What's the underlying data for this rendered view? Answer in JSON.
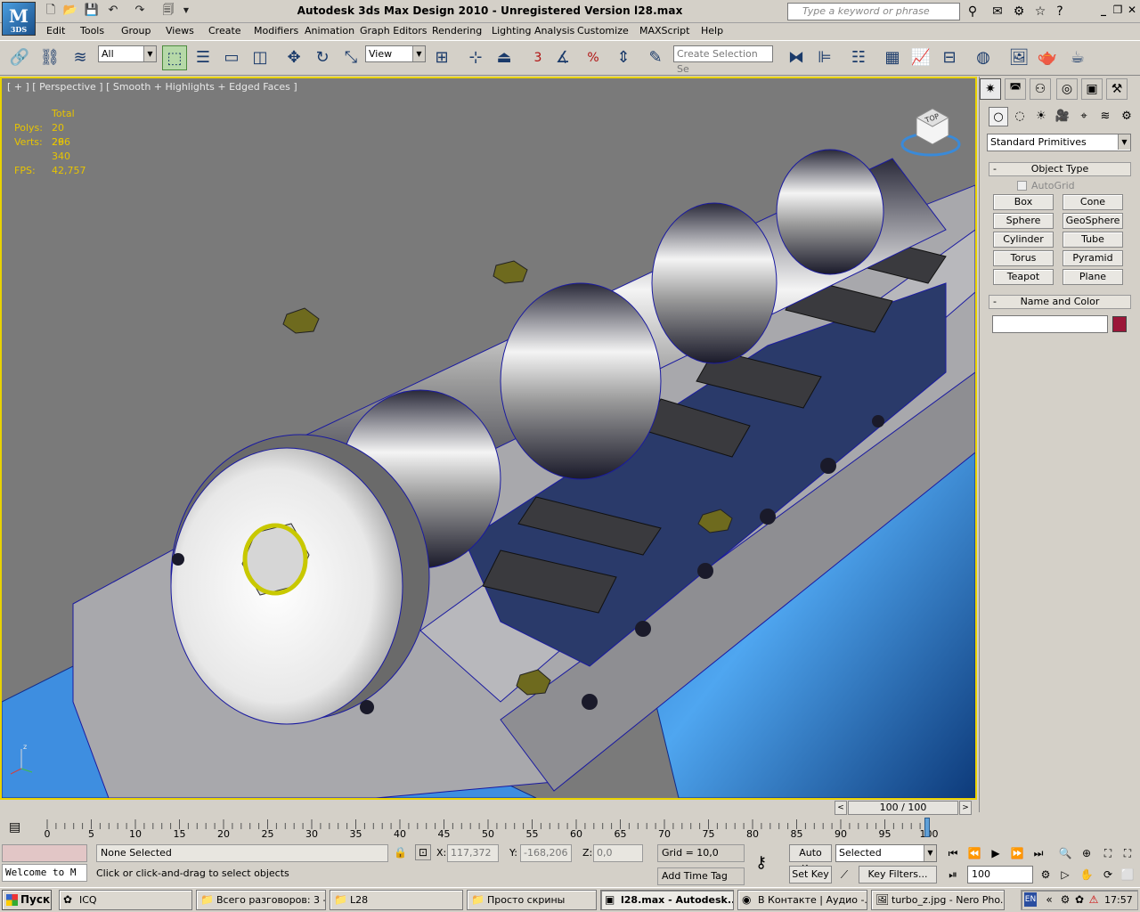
{
  "window": {
    "logo": "M",
    "logo_sub": "3DS",
    "title": "Autodesk 3ds Max Design 2010    -   Unregistered Version      l28.max",
    "search_placeholder": "Type a keyword or phrase"
  },
  "menu": [
    "Edit",
    "Tools",
    "Group",
    "Views",
    "Create",
    "Modifiers",
    "Animation",
    "Graph Editors",
    "Rendering",
    "Lighting Analysis",
    "Customize",
    "MAXScript",
    "Help"
  ],
  "toolbar": {
    "selection_filter": "All",
    "ref_coord": "View",
    "named_selection_placeholder": "Create Selection Se",
    "snap_label": "3",
    "percent_label": "%"
  },
  "viewport": {
    "label": "[ + ] [ Perspective ] [ Smooth + Highlights + Edged Faces ]",
    "stats_header": "Total",
    "polys_label": "Polys:",
    "polys": "20 296",
    "verts_label": "Verts:",
    "verts": "26 340",
    "fps_label": "FPS:",
    "fps": "42,757",
    "viewcube_label": "TOP"
  },
  "command_panel": {
    "category": "Standard Primitives",
    "object_type_title": "Object Type",
    "autogrid": "AutoGrid",
    "primitives": [
      "Box",
      "Cone",
      "Sphere",
      "GeoSphere",
      "Cylinder",
      "Tube",
      "Torus",
      "Pyramid",
      "Teapot",
      "Plane"
    ],
    "name_color_title": "Name and Color",
    "object_color": "#9b1638"
  },
  "timeline": {
    "slider_text": "100 / 100",
    "ticks": [
      "0",
      "5",
      "10",
      "15",
      "20",
      "25",
      "30",
      "35",
      "40",
      "45",
      "50",
      "55",
      "60",
      "65",
      "70",
      "75",
      "80",
      "85",
      "90",
      "95",
      "100"
    ]
  },
  "status": {
    "selection": "None Selected",
    "prompt": "Click or click-and-drag to select objects",
    "welcome": "Welcome to M",
    "x_label": "X:",
    "x": "117,372",
    "y_label": "Y:",
    "y": "-168,206",
    "z_label": "Z:",
    "z": "0,0",
    "grid": "Grid = 10,0",
    "add_time_tag": "Add Time Tag",
    "auto_key": "Auto Key",
    "set_key": "Set Key",
    "key_mode": "Selected",
    "key_filters": "Key Filters...",
    "frame": "100"
  },
  "taskbar": {
    "start": "Пуск",
    "tasks": [
      "ICQ",
      "Всего разговоров: 3 -...",
      "L28",
      "Просто скрины",
      "l28.max - Autodesk...",
      "В Контакте | Аудио -...",
      "turbo_z.jpg - Nero Pho..."
    ],
    "lang": "EN",
    "clock": "17:57"
  }
}
